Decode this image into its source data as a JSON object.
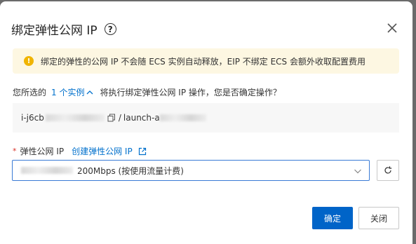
{
  "dialog": {
    "title": "绑定弹性公网 IP",
    "help_icon": "question-circle-icon",
    "close_icon": "close-icon"
  },
  "alert": {
    "icon": "warning-icon",
    "text": "绑定的弹性的公网 IP 不会随 ECS 实例自动释放，EIP 不绑定 ECS 会额外收取配置费用"
  },
  "confirm": {
    "prefix": "您所选的",
    "instance_count_link": "1 个实例",
    "suffix": "将执行绑定弹性公网 IP 操作，您是否确定操作？"
  },
  "instance": {
    "id_prefix": "i-j6cb",
    "separator": "/",
    "name_prefix": "launch-a"
  },
  "eip_field": {
    "label": "弹性公网 IP",
    "create_link": "创建弹性公网 IP",
    "selected_value": "200Mbps (按使用流量计费)"
  },
  "footer": {
    "confirm_label": "确定",
    "cancel_label": "关闭"
  },
  "colors": {
    "primary": "#0064c8",
    "link": "#0070cc",
    "warning": "#f0b400",
    "alert_bg": "#fdf7e2"
  }
}
